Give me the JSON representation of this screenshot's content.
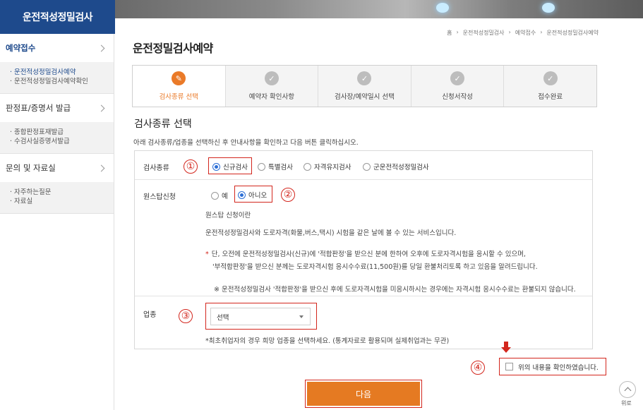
{
  "brand": {
    "title": "운전적성정밀검사"
  },
  "sidebar": {
    "sections": [
      {
        "label": "예약접수",
        "items": [
          "· 운전적성정밀검사예약",
          "· 운전적성정밀검사예약확인"
        ]
      },
      {
        "label": "판정표/증명서 발급",
        "items": [
          "· 종합판정표재발급",
          "· 수검사실증명서발급"
        ]
      },
      {
        "label": "문의 및 자료실",
        "items": [
          "· 자주하는질문",
          "· 자료실"
        ]
      }
    ]
  },
  "breadcrumb": [
    "홈",
    "운전적성정밀검사",
    "예약접수",
    "운전적성정밀검사예약"
  ],
  "page_title": "운전정밀검사예약",
  "steps": [
    {
      "label": "검사종류 선택",
      "active": true
    },
    {
      "label": "예약자 확인사항",
      "active": false
    },
    {
      "label": "검사장/예약일시 선택",
      "active": false
    },
    {
      "label": "신청서작성",
      "active": false
    },
    {
      "label": "접수완료",
      "active": false
    }
  ],
  "section_title": "검사종류 선택",
  "intro": "아래 검사종류/업종을 선택하신 후 안내사항을 확인하고 다음 버튼 클릭하십시오.",
  "form": {
    "exam_type": {
      "label": "검사종류",
      "marker": "①",
      "options": [
        "신규검사",
        "특별검사",
        "자격유지검사",
        "군운전적성정밀검사"
      ],
      "selected": "신규검사"
    },
    "onestop": {
      "label": "원스탑신청",
      "marker": "②",
      "options": [
        "예",
        "아니오"
      ],
      "selected": "아니오",
      "info_title": "원스탑 신청이란",
      "info_desc": "운전적성정밀검사와 도로자격(화물,버스,택시) 시험을 같은 날에 볼 수 있는 서비스입니다.",
      "note_line1": "단, 오전에 운전적성정밀검사(신규)에 '적합판정'을 받으신 분에 한하여 오후에 도로자격시험을 응시할 수 있으며,",
      "note_line2": "'부적합판정'을 받으신 분께는 도로자격시험 응시수수료(11,500원)를 당일 환불처리토록 하고 있음을 알려드립니다.",
      "note_line3": "※ 운전적성정밀검사 '적합판정'을 받으신 후에 도로자격시험을 미응시하시는 경우에는 자격시험 응시수수료는 환불되지 않습니다."
    },
    "industry": {
      "label": "업종",
      "marker": "③",
      "select_value": "선택",
      "hint": "*최초취업자의 경우 희망 업종을 선택하세요. (통계자료로 활용되며 실제취업과는 무관)"
    }
  },
  "confirm": {
    "marker": "④",
    "label": "위의 내용을 확인하였습니다."
  },
  "next_button": "다음",
  "to_top": "위로",
  "colors": {
    "brand": "#1e4a8c",
    "accent": "#e57a22",
    "annotation_red": "#d3261d",
    "radio_selected": "#2b6ed6"
  }
}
